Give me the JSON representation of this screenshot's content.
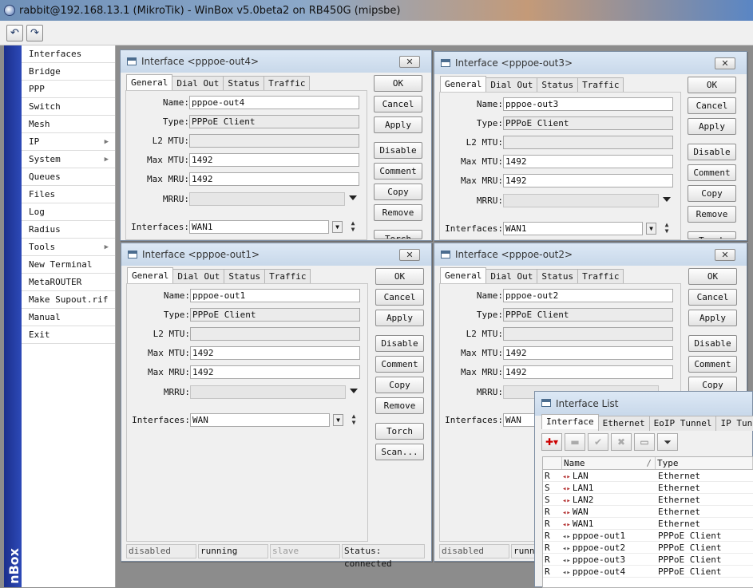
{
  "window": {
    "title": "rabbit@192.168.13.1 (MikroTik) - WinBox v5.0beta2 on RB450G (mipsbe)"
  },
  "toolbar": {
    "undo_icon": "undo-icon",
    "redo_icon": "redo-icon"
  },
  "brand": {
    "text": "nBox"
  },
  "sidebar": {
    "items": [
      {
        "label": "Interfaces",
        "arrow": ""
      },
      {
        "label": "Bridge",
        "arrow": ""
      },
      {
        "label": "PPP",
        "arrow": ""
      },
      {
        "label": "Switch",
        "arrow": ""
      },
      {
        "label": "Mesh",
        "arrow": ""
      },
      {
        "label": "IP",
        "arrow": "▶"
      },
      {
        "label": "System",
        "arrow": "▶"
      },
      {
        "label": "Queues",
        "arrow": ""
      },
      {
        "label": "Files",
        "arrow": ""
      },
      {
        "label": "Log",
        "arrow": ""
      },
      {
        "label": "Radius",
        "arrow": ""
      },
      {
        "label": "Tools",
        "arrow": "▶"
      },
      {
        "label": "New Terminal",
        "arrow": ""
      },
      {
        "label": "MetaROUTER",
        "arrow": ""
      },
      {
        "label": "Make Supout.rif",
        "arrow": ""
      },
      {
        "label": "Manual",
        "arrow": ""
      },
      {
        "label": "Exit",
        "arrow": ""
      }
    ]
  },
  "labels": {
    "tab_general": "General",
    "tab_dialout": "Dial Out",
    "tab_status": "Status",
    "tab_traffic": "Traffic",
    "name": "Name:",
    "type": "Type:",
    "l2mtu": "L2 MTU:",
    "maxmtu": "Max MTU:",
    "maxmru": "Max MRU:",
    "mrru": "MRRU:",
    "interfaces": "Interfaces:",
    "ok": "OK",
    "cancel": "Cancel",
    "apply": "Apply",
    "disable": "Disable",
    "comment": "Comment",
    "copy": "Copy",
    "remove": "Remove",
    "torch": "Torch",
    "scan": "Scan...",
    "close": "✕"
  },
  "win_out4": {
    "title": "Interface <pppoe-out4>",
    "name": "pppoe-out4",
    "type": "PPPoE Client",
    "l2mtu": "",
    "maxmtu": "1492",
    "maxmru": "1492",
    "mrru": "",
    "iface": "WAN1"
  },
  "win_out3": {
    "title": "Interface <pppoe-out3>",
    "name": "pppoe-out3",
    "type": "PPPoE Client",
    "l2mtu": "",
    "maxmtu": "1492",
    "maxmru": "1492",
    "mrru": "",
    "iface": "WAN1"
  },
  "win_out1": {
    "title": "Interface <pppoe-out1>",
    "name": "pppoe-out1",
    "type": "PPPoE Client",
    "l2mtu": "",
    "maxmtu": "1492",
    "maxmru": "1492",
    "mrru": "",
    "iface": "WAN",
    "status": {
      "s1": "disabled",
      "s2": "running",
      "s3": "slave",
      "s4": "Status: connected"
    }
  },
  "win_out2": {
    "title": "Interface <pppoe-out2>",
    "name": "pppoe-out2",
    "type": "PPPoE Client",
    "l2mtu": "",
    "maxmtu": "1492",
    "maxmru": "1492",
    "mrru": "",
    "iface": "WAN",
    "status": {
      "s1": "disabled",
      "s2": "runni"
    }
  },
  "iface_list": {
    "title": "Interface List",
    "tabs": [
      "Interface",
      "Ethernet",
      "EoIP Tunnel",
      "IP Tunnel"
    ],
    "columns": [
      "Name",
      "/",
      "Type"
    ],
    "rows": [
      {
        "flag": "R",
        "name": "LAN",
        "type": "Ethernet",
        "kind": "eth"
      },
      {
        "flag": "S",
        "name": "LAN1",
        "type": "Ethernet",
        "kind": "eth"
      },
      {
        "flag": "S",
        "name": "LAN2",
        "type": "Ethernet",
        "kind": "eth"
      },
      {
        "flag": "R",
        "name": "WAN",
        "type": "Ethernet",
        "kind": "eth"
      },
      {
        "flag": "R",
        "name": "WAN1",
        "type": "Ethernet",
        "kind": "eth"
      },
      {
        "flag": "R",
        "name": "pppoe-out1",
        "type": "PPPoE Client",
        "kind": "ppp"
      },
      {
        "flag": "R",
        "name": "pppoe-out2",
        "type": "PPPoE Client",
        "kind": "ppp"
      },
      {
        "flag": "R",
        "name": "pppoe-out3",
        "type": "PPPoE Client",
        "kind": "ppp"
      },
      {
        "flag": "R",
        "name": "pppoe-out4",
        "type": "PPPoE Client",
        "kind": "ppp"
      }
    ]
  }
}
